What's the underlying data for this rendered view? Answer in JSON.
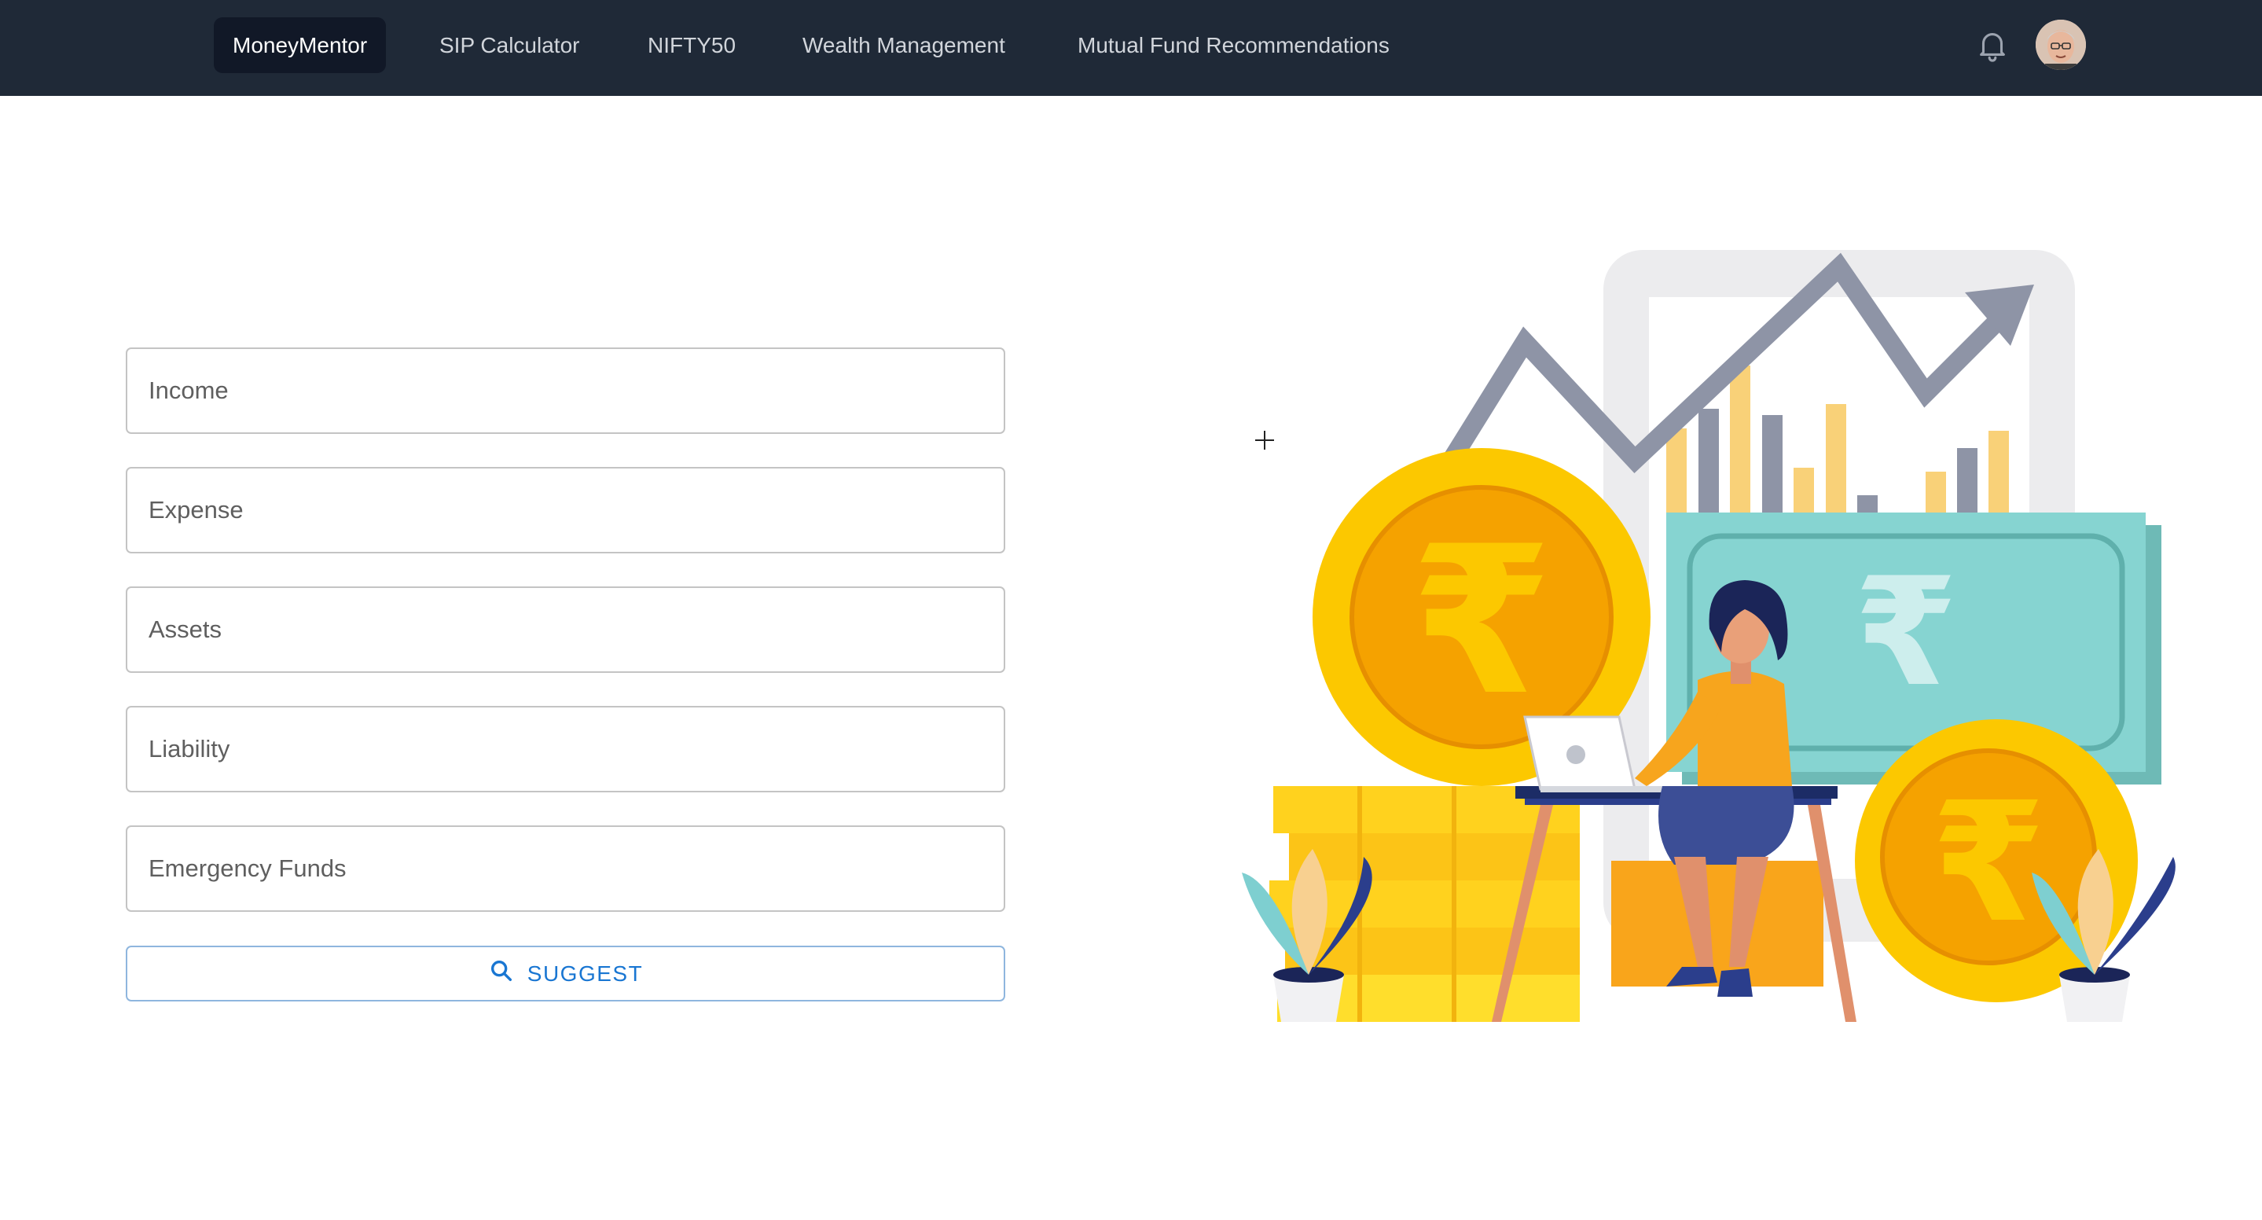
{
  "nav": {
    "items": [
      {
        "label": "MoneyMentor",
        "active": true
      },
      {
        "label": "SIP Calculator"
      },
      {
        "label": "NIFTY50"
      },
      {
        "label": "Wealth Management"
      },
      {
        "label": "Mutual Fund Recommendations"
      }
    ],
    "icons": [
      "bell-icon",
      "avatar"
    ]
  },
  "form": {
    "fields": [
      {
        "placeholder": "Income",
        "value": ""
      },
      {
        "placeholder": "Expense",
        "value": ""
      },
      {
        "placeholder": "Assets",
        "value": ""
      },
      {
        "placeholder": "Liability",
        "value": ""
      },
      {
        "placeholder": "Emergency Funds",
        "value": ""
      }
    ],
    "submit": {
      "label": "SUGGEST",
      "icon": "search-icon"
    }
  },
  "colors": {
    "navbar": "#1f2937",
    "active_nav": "#111827",
    "accent": "#1976d2",
    "coin": "#fbc500",
    "note": "#86d4d1"
  }
}
